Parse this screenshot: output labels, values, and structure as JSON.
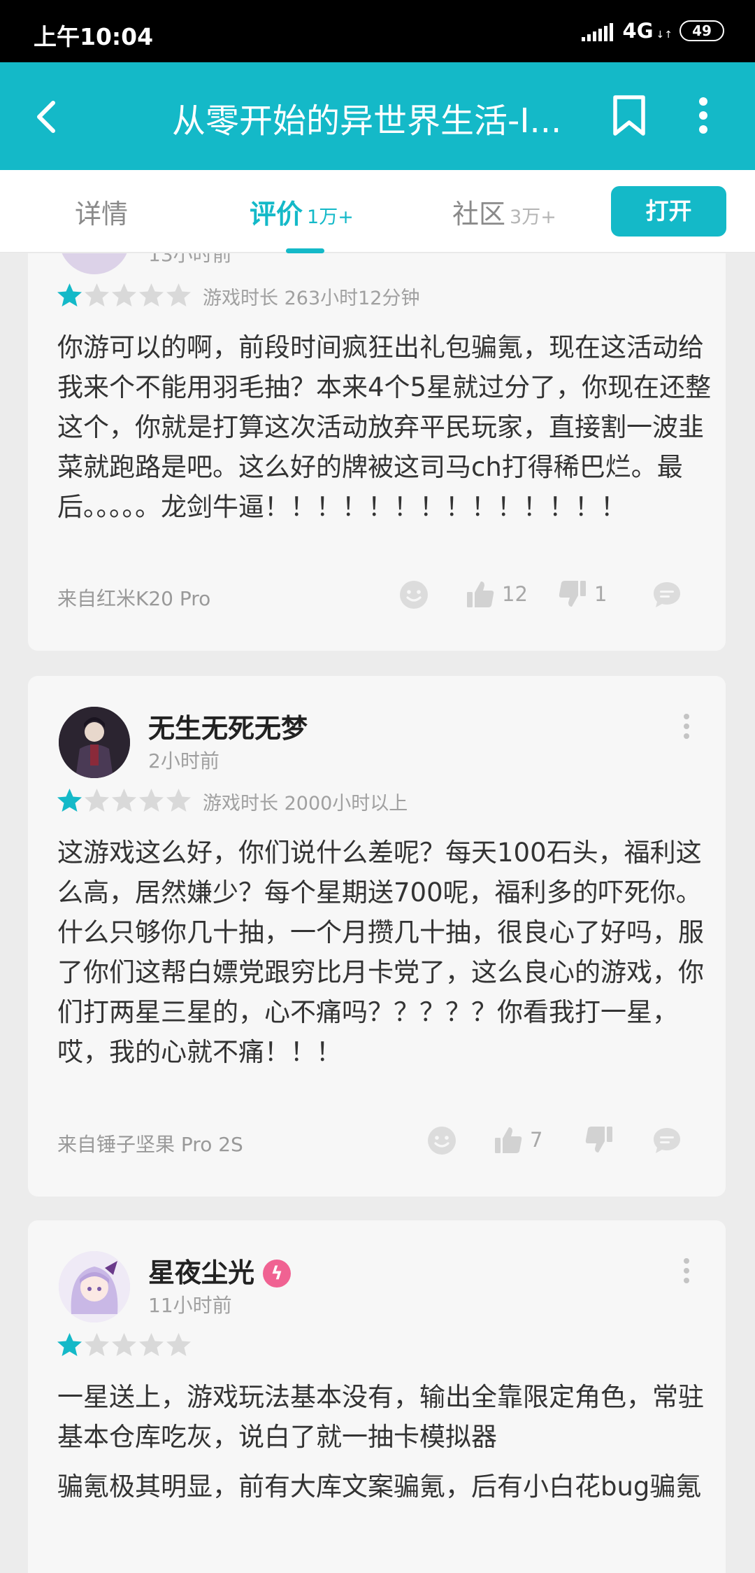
{
  "status_bar": {
    "time": "上午10:04",
    "network": "4G",
    "battery": "49"
  },
  "app_bar": {
    "title": "从零开始的异世界生活-I...",
    "icons": [
      "back-arrow-icon",
      "bookmark-icon",
      "more-vertical-icon"
    ]
  },
  "tabs": [
    {
      "label": "详情",
      "count": ""
    },
    {
      "label": "评价",
      "count": "1万+"
    },
    {
      "label": "社区",
      "count": "3万+"
    }
  ],
  "open_button": "打开",
  "colors": {
    "accent": "#14b9c8",
    "star_filled": "#14b9c8",
    "star_empty": "#d9d9d9",
    "text": "#333333",
    "muted": "#a0a0a0"
  },
  "reviews": [
    {
      "time": "13小时前",
      "rating": 1,
      "playtime": "游戏时长 263小时12分钟",
      "paragraphs": [
        "你游可以的啊，前段时间疯狂出礼包骗氪，现在这活动给我来个不能用羽毛抽？本来4个5星就过分了，你现在还整这个，你就是打算这次活动放弃平民玩家，直接割一波韭菜就跑路是吧。这么好的牌被这司马ch打得稀巴烂。最后。。。。。龙剑牛逼！！！！！！！！！！！！！！"
      ],
      "device": "来自红米K20 Pro",
      "likes": "12",
      "dislikes": "1"
    },
    {
      "username": "无生无死无梦",
      "time": "2小时前",
      "rating": 1,
      "playtime": "游戏时长 2000小时以上",
      "paragraphs": [
        "这游戏这么好，你们说什么差呢？每天100石头，福利这么高，居然嫌少？每个星期送700呢，福利多的吓死你。什么只够你几十抽，一个月攒几十抽，很良心了好吗，服了你们这帮白嫖党跟穷比月卡党了，这么良心的游戏，你们打两星三星的，心不痛吗？？？？？你看我打一星，哎，我的心就不痛！！！"
      ],
      "device": "来自锤子坚果 Pro 2S",
      "likes": "7",
      "dislikes": ""
    },
    {
      "username": "星夜尘光",
      "badge_icon": "verified-badge-icon",
      "time": "11小时前",
      "rating": 1,
      "paragraphs": [
        "一星送上，游戏玩法基本没有，输出全靠限定角色，常驻基本仓库吃灰，说白了就一抽卡模拟器",
        "骗氪极其明显，前有大库文案骗氪，后有小白花bug骗氪"
      ]
    }
  ]
}
